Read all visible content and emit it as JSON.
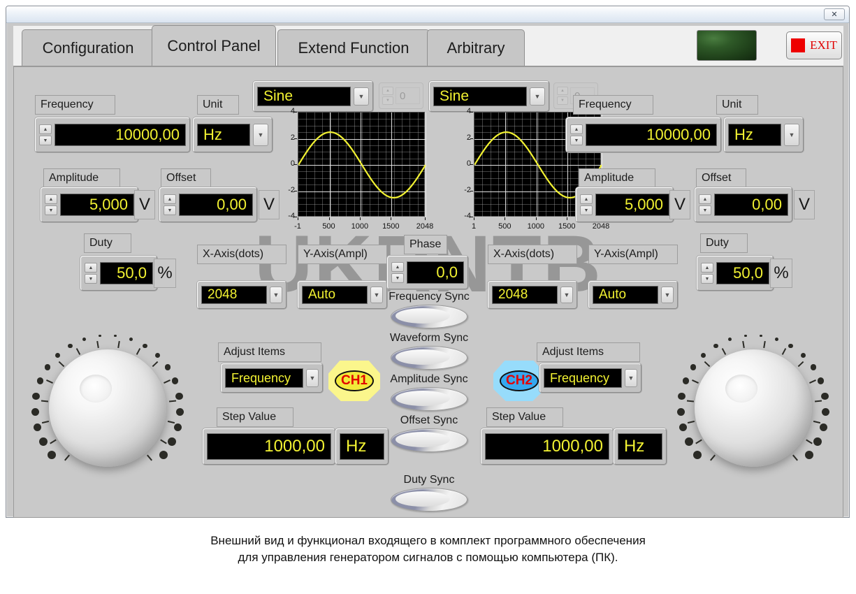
{
  "window": {
    "close_label": "✕"
  },
  "tabs": [
    {
      "label": "Configuration",
      "active": false
    },
    {
      "label": "Control Panel",
      "active": true
    },
    {
      "label": "Extend Function",
      "active": false
    },
    {
      "label": "Arbitrary",
      "active": false
    }
  ],
  "header": {
    "exit_label": "EXIT",
    "lamp_color": "#2f5a28",
    "exit_color": "#e00000"
  },
  "watermark": "UKRNTB",
  "channels": [
    {
      "id": "ch1",
      "badge_label": "CH1",
      "badge_fill": "#f2e93a",
      "badge_halo": "#fbf68c",
      "waveform_value": "Sine",
      "phase_ghost_value": "0",
      "frequency_label": "Frequency",
      "frequency_value": "10000,00",
      "unit_label": "Unit",
      "unit_value": "Hz",
      "amplitude_label": "Amplitude",
      "amplitude_value": "5,000",
      "amplitude_unit": "V",
      "offset_label": "Offset",
      "offset_value": "0,00",
      "offset_unit": "V",
      "duty_label": "Duty",
      "duty_value": "50,0",
      "duty_unit": "%",
      "xaxis_label": "X-Axis(dots)",
      "xaxis_value": "2048",
      "yaxis_label": "Y-Axis(Ampl)",
      "yaxis_value": "Auto",
      "adjust_items_label": "Adjust Items",
      "adjust_items_value": "Frequency",
      "step_value_label": "Step Value",
      "step_value": "1000,00",
      "step_unit": "Hz"
    },
    {
      "id": "ch2",
      "badge_label": "CH2",
      "badge_fill": "#35a8ef",
      "badge_halo": "#97dcfb",
      "waveform_value": "Sine",
      "phase_ghost_value": "0",
      "frequency_label": "Frequency",
      "frequency_value": "10000,00",
      "unit_label": "Unit",
      "unit_value": "Hz",
      "amplitude_label": "Amplitude",
      "amplitude_value": "5,000",
      "amplitude_unit": "V",
      "offset_label": "Offset",
      "offset_value": "0,00",
      "offset_unit": "V",
      "duty_label": "Duty",
      "duty_value": "50,0",
      "duty_unit": "%",
      "xaxis_label": "X-Axis(dots)",
      "xaxis_value": "2048",
      "yaxis_label": "Y-Axis(Ampl)",
      "yaxis_value": "Auto",
      "adjust_items_label": "Adjust Items",
      "adjust_items_value": "Frequency",
      "step_value_label": "Step Value",
      "step_value": "1000,00",
      "step_unit": "Hz"
    }
  ],
  "center": {
    "phase_label": "Phase",
    "phase_value": "0,0",
    "sync_buttons": [
      {
        "label": "Frequency Sync"
      },
      {
        "label": "Waveform Sync"
      },
      {
        "label": "Amplitude Sync"
      },
      {
        "label": "Offset Sync"
      },
      {
        "label": "Duty Sync"
      }
    ]
  },
  "chart_data": [
    {
      "type": "line",
      "title": "",
      "xlabel": "",
      "ylabel": "",
      "series": [
        {
          "name": "CH1 Sine",
          "color": "#f2f232",
          "amplitude": 2.5,
          "periods": 1,
          "phase_deg": 0
        }
      ],
      "x": [
        -1,
        500,
        1000,
        1500,
        2048
      ],
      "xticklabels": [
        "-1",
        "500",
        "1000",
        "1500",
        "2048"
      ],
      "yticklabels": [
        "-4",
        "-2",
        "0",
        "2",
        "4"
      ],
      "xlim": [
        -1,
        2048
      ],
      "ylim": [
        -4,
        4
      ],
      "grid": true,
      "background": "#000000",
      "gridcolor": "#b9b9b9"
    },
    {
      "type": "line",
      "title": "",
      "xlabel": "",
      "ylabel": "",
      "series": [
        {
          "name": "CH2 Sine",
          "color": "#f2f232",
          "amplitude": 2.5,
          "periods": 1,
          "phase_deg": 0
        }
      ],
      "x": [
        1,
        500,
        1000,
        1500,
        2048
      ],
      "xticklabels": [
        "1",
        "500",
        "1000",
        "1500",
        "2048"
      ],
      "yticklabels": [
        "-4",
        "-2",
        "0",
        "2",
        "4"
      ],
      "xlim": [
        1,
        2048
      ],
      "ylim": [
        -4,
        4
      ],
      "grid": true,
      "background": "#000000",
      "gridcolor": "#b9b9b9"
    }
  ],
  "caption": {
    "line1": "Внешний вид и функционал входящего в комплект программного обеспечения",
    "line2": "для управления генератором сигналов с помощью компьютера (ПК)."
  }
}
